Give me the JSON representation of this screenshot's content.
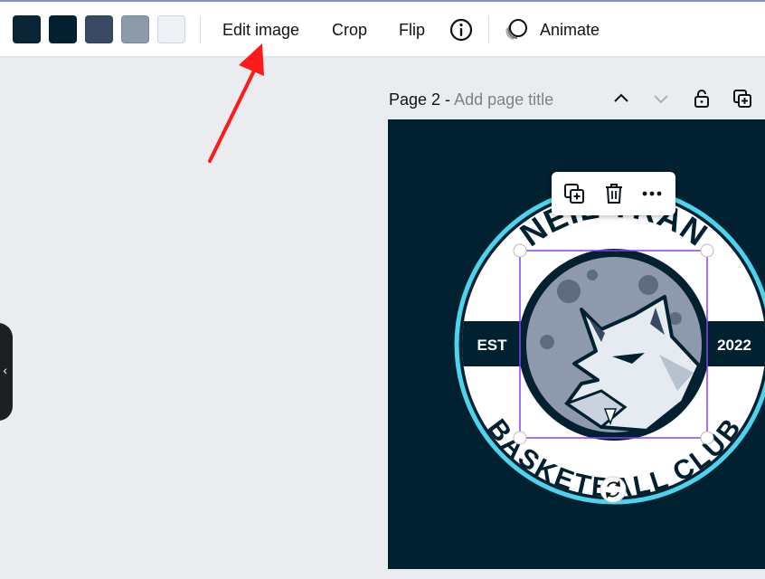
{
  "toolbar": {
    "swatches": [
      {
        "name": "color-swatch-1",
        "color": "#0a2535"
      },
      {
        "name": "color-swatch-2",
        "color": "#02202f"
      },
      {
        "name": "color-swatch-3",
        "color": "#3a4963"
      },
      {
        "name": "color-swatch-4",
        "color": "#8c9bac"
      },
      {
        "name": "color-swatch-5",
        "color": "#edf1f6"
      }
    ],
    "edit_image_label": "Edit image",
    "crop_label": "Crop",
    "flip_label": "Flip",
    "info_icon": "info-icon",
    "animate_icon": "animate-icon",
    "animate_label": "Animate"
  },
  "page": {
    "title_prefix": "Page 2 - ",
    "title_placeholder": "Add page title",
    "icons": [
      "chevron-up-icon",
      "chevron-down-icon",
      "lock-icon",
      "duplicate-page-icon"
    ]
  },
  "context_menu": {
    "icons": [
      "duplicate-icon",
      "trash-icon",
      "more-icon"
    ]
  },
  "logo": {
    "top_text": "NEIL TRAN",
    "bottom_text": "BASKETBALL CLUB",
    "left_band": "EST",
    "right_band": "2022"
  },
  "colors": {
    "canvas_bg": "#012030",
    "ring": "#4dd4ec",
    "selection": "#8b3dff",
    "arrow": "#ff1a1a"
  },
  "side_panel": {
    "toggle_glyph": "‹"
  }
}
